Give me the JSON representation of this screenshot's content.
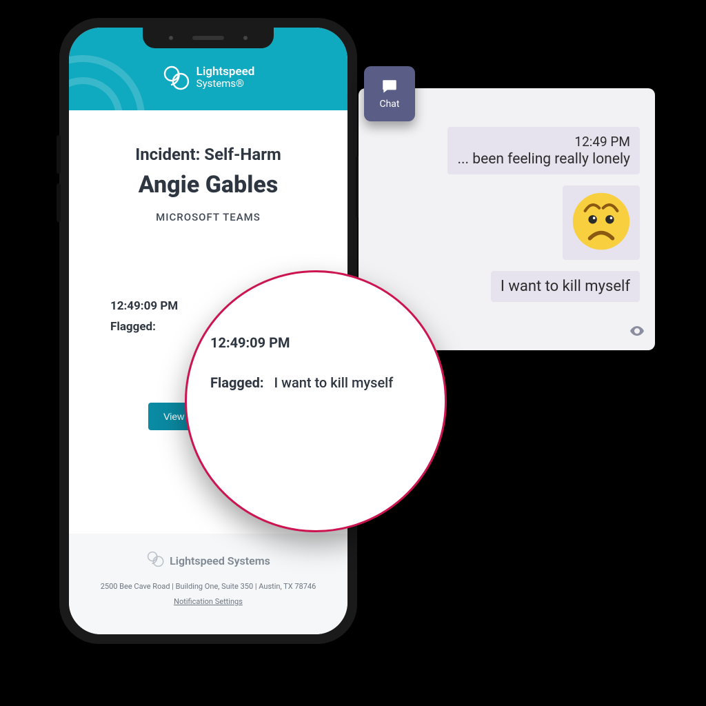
{
  "brand": {
    "line1": "Lightspeed",
    "line2": "Systems®"
  },
  "incident": {
    "label": "Incident: Self-Harm",
    "name": "Angie Gables",
    "source": "MICROSOFT TEAMS",
    "time": "12:49:09 PM",
    "flagged_label": "Flagged:",
    "cta": "View Student Activity"
  },
  "footer": {
    "brand": "Lightspeed Systems",
    "address": "2500 Bee Cave Road | Building One, Suite 350 | Austin, TX 78746",
    "settings_link": "Notification Settings"
  },
  "magnifier": {
    "time": "12:49:09 PM",
    "flagged_label": "Flagged:",
    "message": "I want to kill myself"
  },
  "chat": {
    "badge_label": "Chat",
    "messages": [
      {
        "time": "12:49 PM",
        "text": "... been feeling really lonely"
      },
      {
        "emoji": "worried"
      },
      {
        "text": "I want to kill myself"
      }
    ]
  },
  "colors": {
    "brand_teal": "#0fa9c0",
    "cta_teal": "#0b8aa3",
    "magnifier_ring": "#cc1550",
    "chat_badge": "#5a5e86",
    "bubble": "#e6e3ee"
  }
}
